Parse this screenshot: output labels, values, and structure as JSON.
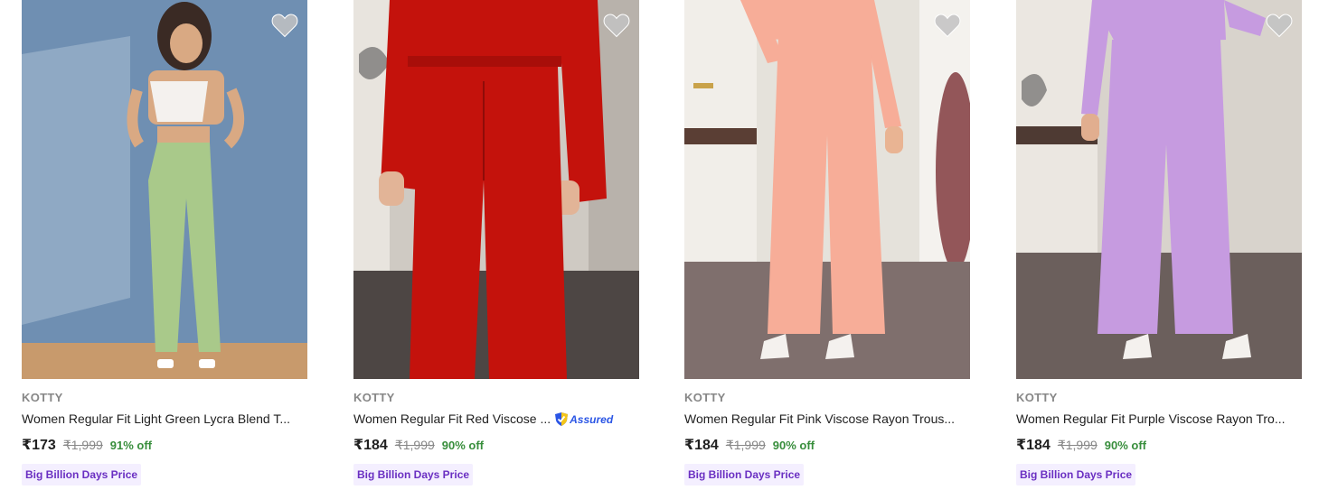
{
  "products": [
    {
      "brand": "KOTTY",
      "title": "Women Regular Fit Light Green Lycra Blend T...",
      "price": "₹173",
      "mrp": "₹1,999",
      "discount": "91% off",
      "badge": "Big Billion Days Price",
      "assured": false,
      "colors": {
        "bg": "#6f8fb2",
        "garment": "#a9c98a",
        "top": "#f4f1ee",
        "floor": "#c89a6c"
      }
    },
    {
      "brand": "KOTTY",
      "title": "Women Regular Fit Red Viscose ...",
      "price": "₹184",
      "mrp": "₹1,999",
      "discount": "90% off",
      "badge": "Big Billion Days Price",
      "assured": true,
      "assured_label": "Assured",
      "colors": {
        "bg": "#cfcac3",
        "garment": "#c4120c",
        "floor": "#4d4644"
      }
    },
    {
      "brand": "KOTTY",
      "title": "Women Regular Fit Pink Viscose Rayon Trous...",
      "price": "₹184",
      "mrp": "₹1,999",
      "discount": "90% off",
      "badge": "Big Billion Days Price",
      "assured": false,
      "colors": {
        "bg": "#e5e2db",
        "garment": "#f7ad98",
        "floor": "#7f6f6d"
      }
    },
    {
      "brand": "KOTTY",
      "title": "Women Regular Fit Purple Viscose Rayon Tro...",
      "price": "₹184",
      "mrp": "₹1,999",
      "discount": "90% off",
      "badge": "Big Billion Days Price",
      "assured": false,
      "colors": {
        "bg": "#d8d3cc",
        "garment": "#c69be0",
        "floor": "#6b5f5c"
      }
    }
  ],
  "icons": {
    "wishlist": "heart-icon",
    "assured": "shield-check-icon"
  },
  "theme": {
    "discount_green": "#388e3c",
    "badge_purple": "#6a2fc2",
    "assured_blue": "#2a55e5"
  }
}
